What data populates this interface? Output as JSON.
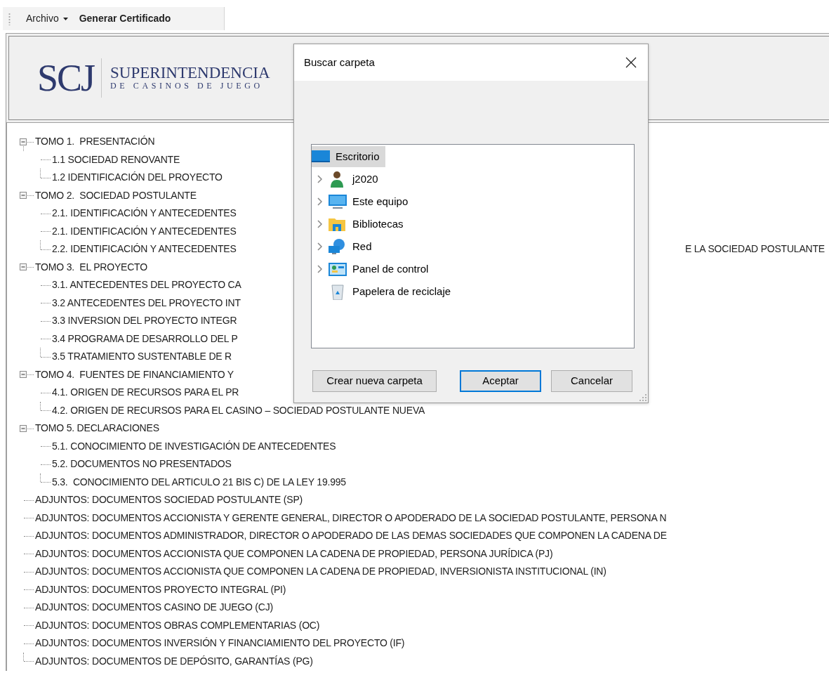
{
  "toolbar": {
    "items": [
      {
        "label": "Archivo",
        "kind": "menu"
      },
      {
        "label": "Generar Certificado",
        "kind": "command"
      }
    ]
  },
  "logo": {
    "mark": "SCJ",
    "name": "SUPERINTENDENCIA",
    "subtitle": "DE CASINOS DE JUEGO"
  },
  "tree": [
    {
      "label": "TOMO 1.  PRESENTACIÓN",
      "expanded": true,
      "children": [
        {
          "label": "1.1 SOCIEDAD RENOVANTE"
        },
        {
          "label": "1.2 IDENTIFICACIÓN DEL PROYECTO"
        }
      ]
    },
    {
      "label": "TOMO 2.  SOCIEDAD POSTULANTE",
      "expanded": true,
      "children": [
        {
          "label": "2.1. IDENTIFICACIÓN Y ANTECEDENTES"
        },
        {
          "label": "2.1. IDENTIFICACIÓN Y ANTECEDENTES"
        },
        {
          "label": "2.2. IDENTIFICACIÓN Y ANTECEDENTES",
          "label_after_dialog": "E LA SOCIEDAD POSTULANTE"
        }
      ]
    },
    {
      "label": "TOMO 3.  EL PROYECTO",
      "expanded": true,
      "children": [
        {
          "label": "3.1. ANTECEDENTES DEL PROYECTO CA"
        },
        {
          "label": "3.2 ANTECEDENTES DEL PROYECTO INT"
        },
        {
          "label": "3.3 INVERSION DEL PROYECTO INTEGR"
        },
        {
          "label": "3.4 PROGRAMA DE DESARROLLO DEL P"
        },
        {
          "label": "3.5 TRATAMIENTO SUSTENTABLE DE R"
        }
      ]
    },
    {
      "label": "TOMO 4.  FUENTES DE FINANCIAMIENTO Y",
      "expanded": true,
      "children": [
        {
          "label": "4.1. ORIGEN DE RECURSOS PARA EL PR"
        },
        {
          "label": "4.2. ORIGEN DE RECURSOS PARA EL CASINO – SOCIEDAD POSTULANTE NUEVA"
        }
      ]
    },
    {
      "label": "TOMO 5. DECLARACIONES",
      "expanded": true,
      "children": [
        {
          "label": "5.1. CONOCIMIENTO DE INVESTIGACIÓN DE ANTECEDENTES"
        },
        {
          "label": "5.2. DOCUMENTOS NO PRESENTADOS"
        },
        {
          "label": "5.3.  CONOCIMIENTO DEL ARTICULO 21 BIS C) DE LA LEY 19.995"
        }
      ]
    },
    {
      "label": "ADJUNTOS: DOCUMENTOS SOCIEDAD POSTULANTE (SP)"
    },
    {
      "label": "ADJUNTOS: DOCUMENTOS ACCIONISTA Y GERENTE GENERAL, DIRECTOR O APODERADO DE LA SOCIEDAD POSTULANTE, PERSONA N"
    },
    {
      "label": "ADJUNTOS: DOCUMENTOS ADMINISTRADOR, DIRECTOR O APODERADO DE LAS DEMAS SOCIEDADES QUE COMPONEN LA CADENA DE"
    },
    {
      "label": "ADJUNTOS: DOCUMENTOS ACCIONISTA QUE COMPONEN LA CADENA DE PROPIEDAD, PERSONA JURÍDICA (PJ)"
    },
    {
      "label": "ADJUNTOS: DOCUMENTOS ACCIONISTA QUE COMPONEN LA CADENA DE PROPIEDAD, INVERSIONISTA INSTITUCIONAL (IN)"
    },
    {
      "label": "ADJUNTOS: DOCUMENTOS PROYECTO INTEGRAL (PI)"
    },
    {
      "label": "ADJUNTOS: DOCUMENTOS CASINO DE JUEGO (CJ)"
    },
    {
      "label": "ADJUNTOS: DOCUMENTOS OBRAS COMPLEMENTARIAS (OC)"
    },
    {
      "label": "ADJUNTOS: DOCUMENTOS INVERSIÓN Y FINANCIAMIENTO DEL PROYECTO (IF)"
    },
    {
      "label": "ADJUNTOS: DOCUMENTOS DE DEPÓSITO, GARANTÍAS (PG)"
    }
  ],
  "dialog": {
    "title": "Buscar carpeta",
    "folders": [
      {
        "label": "Escritorio",
        "kind": "desktop",
        "selected": true,
        "children": [
          {
            "label": "j2020",
            "kind": "user",
            "selected": false,
            "has_children": true
          },
          {
            "label": "Este equipo",
            "kind": "computer",
            "selected": false,
            "has_children": true
          },
          {
            "label": "Bibliotecas",
            "kind": "library",
            "selected": false,
            "has_children": true
          },
          {
            "label": "Red",
            "kind": "network",
            "selected": false,
            "has_children": true
          },
          {
            "label": "Panel de control",
            "kind": "control-panel",
            "selected": false,
            "has_children": true
          },
          {
            "label": "Papelera de reciclaje",
            "kind": "recycle-bin",
            "selected": false,
            "has_children": false
          }
        ]
      }
    ],
    "buttons": [
      {
        "label": "Crear nueva carpeta",
        "default": false
      },
      {
        "label": "Aceptar",
        "default": true
      },
      {
        "label": "Cancelar",
        "default": false
      }
    ]
  }
}
